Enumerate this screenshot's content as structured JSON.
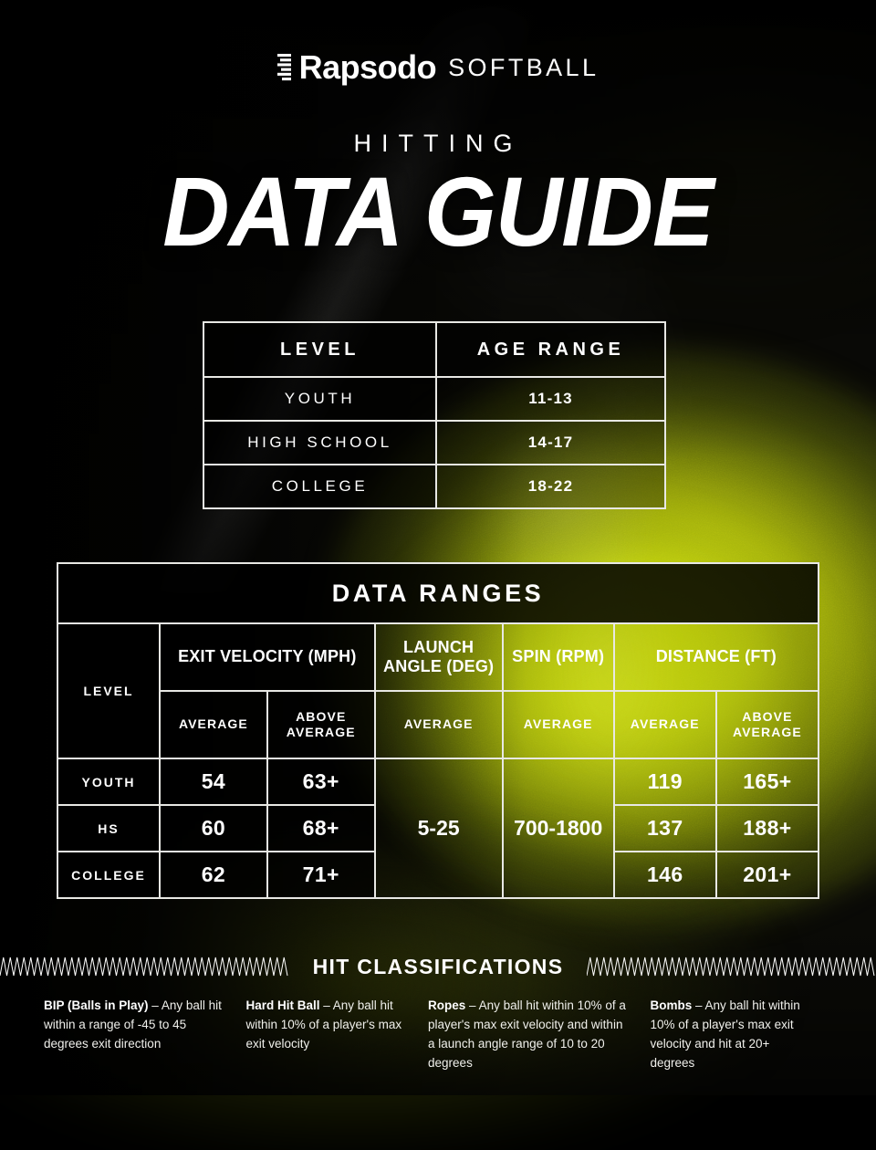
{
  "brand": {
    "logo_mark": "rapsodo-bars-icon",
    "name": "Rapsodo",
    "sport": "SOFTBALL"
  },
  "header": {
    "kicker": "HITTING",
    "title": "DATA GUIDE"
  },
  "levels_table": {
    "name": "level-age-range-table",
    "columns": [
      "LEVEL",
      "AGE RANGE"
    ],
    "rows": [
      {
        "level": "YOUTH",
        "age_range": "11-13"
      },
      {
        "level": "HIGH SCHOOL",
        "age_range": "14-17"
      },
      {
        "level": "COLLEGE",
        "age_range": "18-22"
      }
    ]
  },
  "ranges_table": {
    "banner": "DATA RANGES",
    "level_header": "LEVEL",
    "groups": [
      {
        "label": "EXIT VELOCITY (MPH)",
        "subs": [
          "AVERAGE",
          "ABOVE AVERAGE"
        ]
      },
      {
        "label": "LAUNCH ANGLE (DEG)",
        "subs": [
          "AVERAGE"
        ]
      },
      {
        "label": "SPIN (RPM)",
        "subs": [
          "AVERAGE"
        ]
      },
      {
        "label": "DISTANCE (FT)",
        "subs": [
          "AVERAGE",
          "ABOVE AVERAGE"
        ]
      }
    ],
    "sub_labels": {
      "average": "AVERAGE",
      "above_average_line1": "ABOVE",
      "above_average_line2": "AVERAGE"
    },
    "rows": [
      {
        "level": "YOUTH",
        "ev_avg": "54",
        "ev_above": "63+",
        "dist_avg": "119",
        "dist_above": "165+"
      },
      {
        "level": "HS",
        "ev_avg": "60",
        "ev_above": "68+",
        "dist_avg": "137",
        "dist_above": "188+"
      },
      {
        "level": "COLLEGE",
        "ev_avg": "62",
        "ev_above": "71+",
        "dist_avg": "146",
        "dist_above": "201+"
      }
    ],
    "launch_angle_all": "5-25",
    "spin_all": "700-1800"
  },
  "hit_classifications": {
    "title": "HIT CLASSIFICATIONS",
    "divider_icon": "zigzag-wave-icon",
    "items": [
      {
        "term": "BIP (Balls in Play)",
        "dash": " – ",
        "definition": "Any ball hit within a range of -45 to 45 degrees exit direction"
      },
      {
        "term": "Hard Hit Ball",
        "dash": " – ",
        "definition": "Any ball hit within 10% of a player's max exit velocity"
      },
      {
        "term": "Ropes",
        "dash": " – ",
        "definition": "Any ball hit within 10% of a player's max exit velocity and within a launch angle range of 10 to 20 degrees"
      },
      {
        "term": "Bombs",
        "dash": " – ",
        "definition": "Any ball hit within 10% of a player's max exit velocity and hit at 20+ degrees"
      }
    ]
  },
  "colors": {
    "accent_yellow": "#D9E60D",
    "accent_yellow_bright": "#E4F20A",
    "background_black": "#0A0A06",
    "text_white": "#FFFFFF",
    "border_white": "#E8E8E4"
  }
}
